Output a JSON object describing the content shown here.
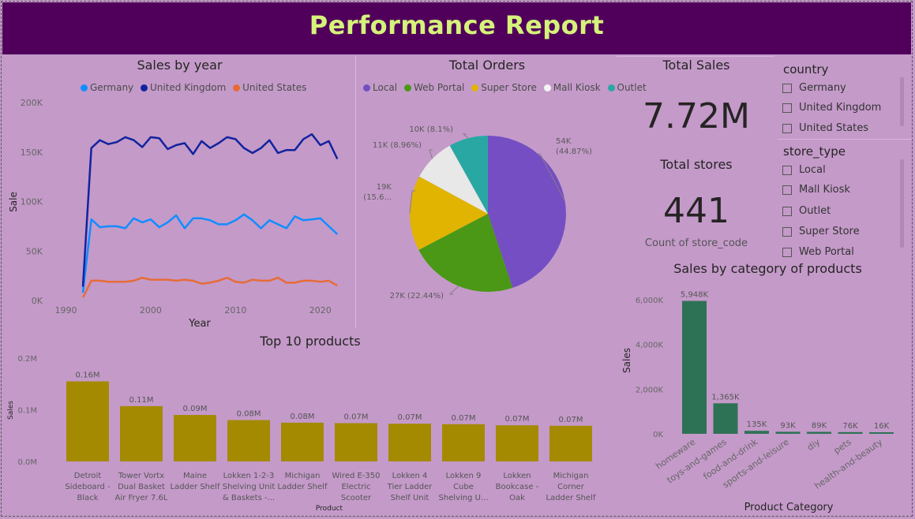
{
  "header": {
    "title": "Performance Report"
  },
  "sales_by_year": {
    "title": "Sales by year",
    "legend": [
      {
        "name": "Germany",
        "color": "#118dff"
      },
      {
        "name": "United Kingdom",
        "color": "#12239e"
      },
      {
        "name": "United States",
        "color": "#e66c37"
      }
    ],
    "yaxis_title": "Sale",
    "xaxis_title": "Year",
    "yticks": [
      "0K",
      "50K",
      "100K",
      "150K",
      "200K"
    ],
    "xticks": [
      "1990",
      "2000",
      "2010",
      "2020"
    ]
  },
  "total_orders": {
    "title": "Total Orders",
    "legend": [
      {
        "name": "Local",
        "color": "#744ec2"
      },
      {
        "name": "Web Portal",
        "color": "#4a9816"
      },
      {
        "name": "Super Store",
        "color": "#e0b400"
      },
      {
        "name": "Mall Kiosk",
        "color": "#e8e8e8"
      },
      {
        "name": "Outlet",
        "color": "#29a8a3"
      }
    ]
  },
  "kpis": {
    "total_sales_label": "Total Sales",
    "total_sales_value": "7.72M",
    "total_stores_label": "Total stores",
    "total_stores_value": "441",
    "total_stores_caption": "Count of store_code"
  },
  "slicers": {
    "country": {
      "title": "country",
      "items": [
        "Germany",
        "United Kingdom",
        "United States"
      ]
    },
    "store_type": {
      "title": "store_type",
      "items": [
        "Local",
        "Mall Kiosk",
        "Outlet",
        "Super Store",
        "Web Portal"
      ]
    }
  },
  "top_products": {
    "title": "Top 10 products",
    "yaxis_title": "Sales",
    "xaxis_title": "Product",
    "yticks": [
      "0.0M",
      "0.1M",
      "0.2M"
    ]
  },
  "category_sales": {
    "title": "Sales by category of products",
    "yaxis_title": "Sales",
    "xaxis_title": "Product Category",
    "yticks": [
      "0K",
      "2,000K",
      "4,000K",
      "6,000K"
    ]
  },
  "chart_data": [
    {
      "type": "line",
      "title": "Sales by year",
      "xlabel": "Year",
      "ylabel": "Sale",
      "xlim": [
        1988,
        2023
      ],
      "ylim": [
        0,
        200000
      ],
      "x": [
        1992,
        1993,
        1994,
        1995,
        1996,
        1997,
        1998,
        1999,
        2000,
        2001,
        2002,
        2003,
        2004,
        2005,
        2006,
        2007,
        2008,
        2009,
        2010,
        2011,
        2012,
        2013,
        2014,
        2015,
        2016,
        2017,
        2018,
        2019,
        2020,
        2021,
        2022
      ],
      "series": [
        {
          "name": "Germany",
          "color": "#118dff",
          "values": [
            8000,
            82000,
            74000,
            75000,
            75000,
            73000,
            83000,
            79000,
            82000,
            74000,
            79000,
            86000,
            73000,
            83000,
            83000,
            81000,
            77000,
            77000,
            81000,
            87000,
            81000,
            73000,
            81000,
            77000,
            73000,
            85000,
            81000,
            82000,
            83000,
            75000,
            67000
          ]
        },
        {
          "name": "United Kingdom",
          "color": "#12239e",
          "values": [
            14000,
            154000,
            162000,
            158000,
            160000,
            165000,
            162000,
            155000,
            165000,
            164000,
            153000,
            157000,
            159000,
            148000,
            161000,
            154000,
            159000,
            165000,
            163000,
            154000,
            149000,
            154000,
            162000,
            149000,
            152000,
            152000,
            163000,
            168000,
            157000,
            161000,
            143000
          ]
        },
        {
          "name": "United States",
          "color": "#e66c37",
          "values": [
            3000,
            20000,
            20000,
            19000,
            19000,
            19000,
            20000,
            23000,
            21000,
            21000,
            21000,
            20000,
            21000,
            20000,
            17000,
            18000,
            20000,
            23000,
            19000,
            18000,
            21000,
            20000,
            20000,
            23000,
            18000,
            18000,
            20000,
            20000,
            19000,
            20000,
            15000
          ]
        }
      ]
    },
    {
      "type": "pie",
      "title": "Total Orders",
      "categories": [
        "Local",
        "Web Portal",
        "Super Store",
        "Mall Kiosk",
        "Outlet"
      ],
      "values": [
        44.87,
        22.44,
        15.6,
        8.96,
        8.1
      ],
      "labels": [
        "54K (44.87%)",
        "27K (22.44%)",
        "19K (15.6...)",
        "11K (8.96%)",
        "10K (8.1%)"
      ],
      "colors": [
        "#744ec2",
        "#4a9816",
        "#e0b400",
        "#e8e8e8",
        "#29a8a3"
      ]
    },
    {
      "type": "bar",
      "title": "Top 10 products",
      "xlabel": "Product",
      "ylabel": "Sales",
      "ylim": [
        0,
        0.2
      ],
      "categories": [
        "Detroit Sideboard - Black",
        "Tower Vortx Dual Basket Air Fryer 7.6L",
        "Maine Ladder Shelf",
        "Lokken 1-2-3 Shelving Unit & Baskets -...",
        "Michigan Ladder Shelf",
        "Wired E-350 Electric Scooter",
        "Lokken 4 Tier Ladder Shelf Unit",
        "Lokken 9 Cube Shelving U...",
        "Lokken Bookcase - Oak",
        "Michigan Corner Ladder Shelf"
      ],
      "values": [
        0.155,
        0.107,
        0.09,
        0.08,
        0.075,
        0.074,
        0.073,
        0.072,
        0.07,
        0.069
      ],
      "data_labels": [
        "0.16M",
        "0.11M",
        "0.09M",
        "0.08M",
        "0.08M",
        "0.07M",
        "0.07M",
        "0.07M",
        "0.07M",
        "0.07M"
      ],
      "color": "#a48a00"
    },
    {
      "type": "bar",
      "title": "Sales by category of products",
      "xlabel": "Product Category",
      "ylabel": "Sales",
      "ylim": [
        0,
        6500
      ],
      "categories": [
        "homeware",
        "toys-and-games",
        "food-and-drink",
        "sports-and-leisure",
        "diy",
        "pets",
        "health-and-beauty"
      ],
      "values": [
        5948,
        1365,
        135,
        93,
        89,
        76,
        16
      ],
      "data_labels": [
        "5,948K",
        "1,365K",
        "135K",
        "93K",
        "89K",
        "76K",
        "16K"
      ],
      "color": "#2e7255"
    }
  ]
}
